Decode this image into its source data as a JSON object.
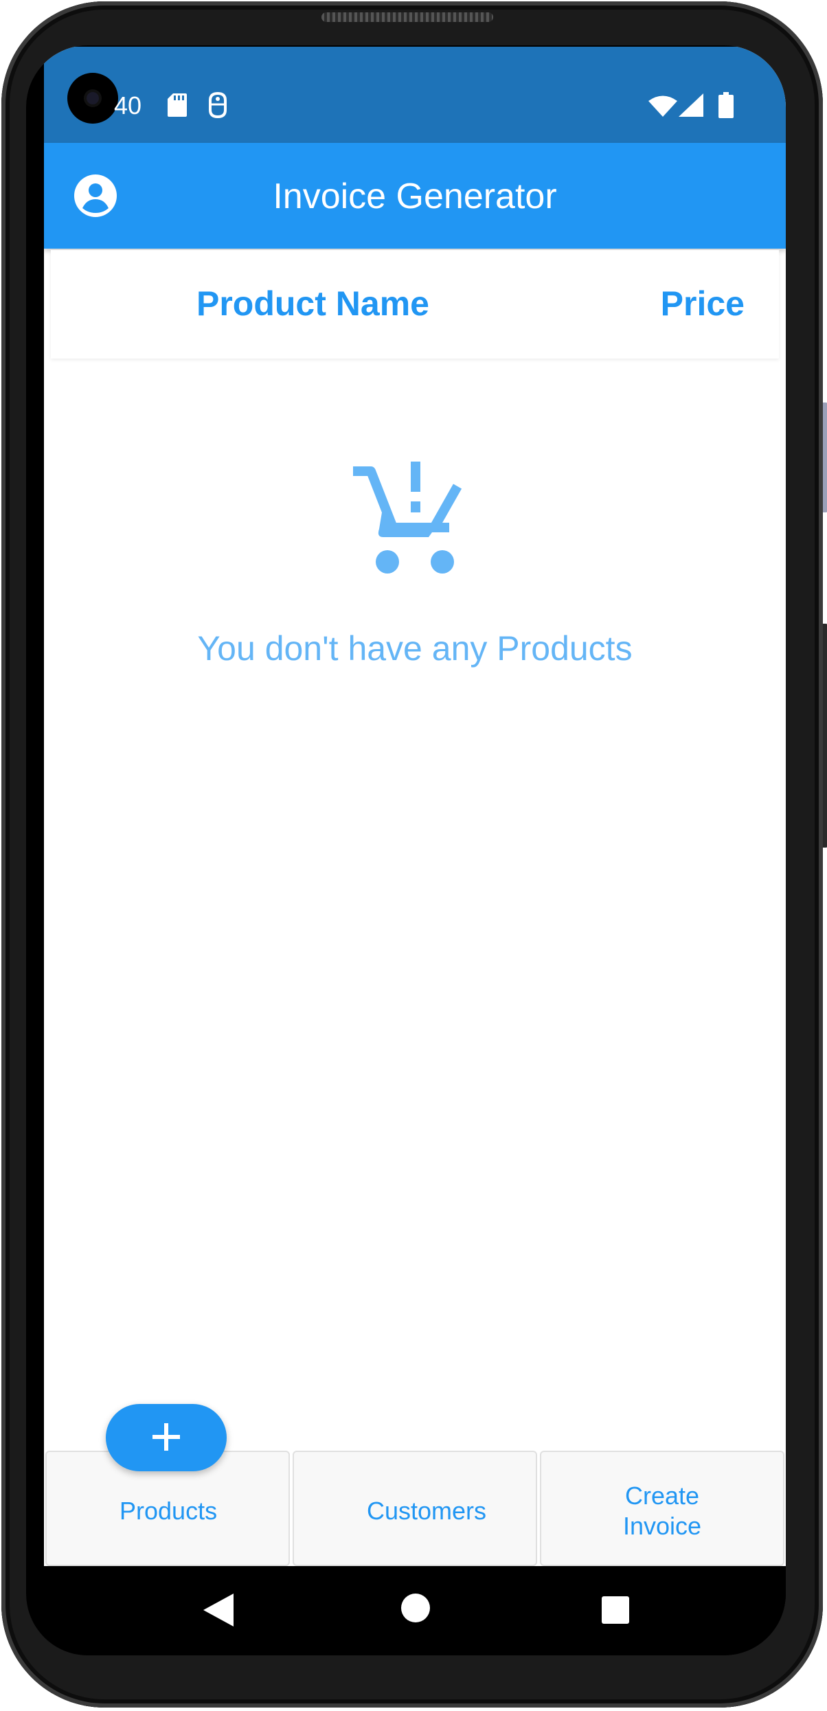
{
  "status_bar": {
    "time": "40",
    "icons": [
      "sd-card-icon",
      "accessibility-icon",
      "wifi-icon",
      "signal-icon",
      "battery-icon"
    ]
  },
  "app_bar": {
    "title": "Invoice Generator",
    "profile_icon": "account-circle-icon"
  },
  "table_header": {
    "product_name": "Product Name",
    "price": "Price"
  },
  "empty_state": {
    "icon": "remove-shopping-cart-icon",
    "message": "You don't have any Products"
  },
  "fab": {
    "icon": "add-icon"
  },
  "bottom_nav": {
    "tabs": [
      {
        "label": "Products"
      },
      {
        "label": "Customers"
      },
      {
        "label": "Create Invoice"
      }
    ]
  },
  "system_nav": {
    "icons": [
      "back-icon",
      "home-icon",
      "recents-icon"
    ]
  },
  "colors": {
    "primary": "#2196f3",
    "status_bar": "#1e73b8",
    "empty_text": "#64b5f6"
  }
}
